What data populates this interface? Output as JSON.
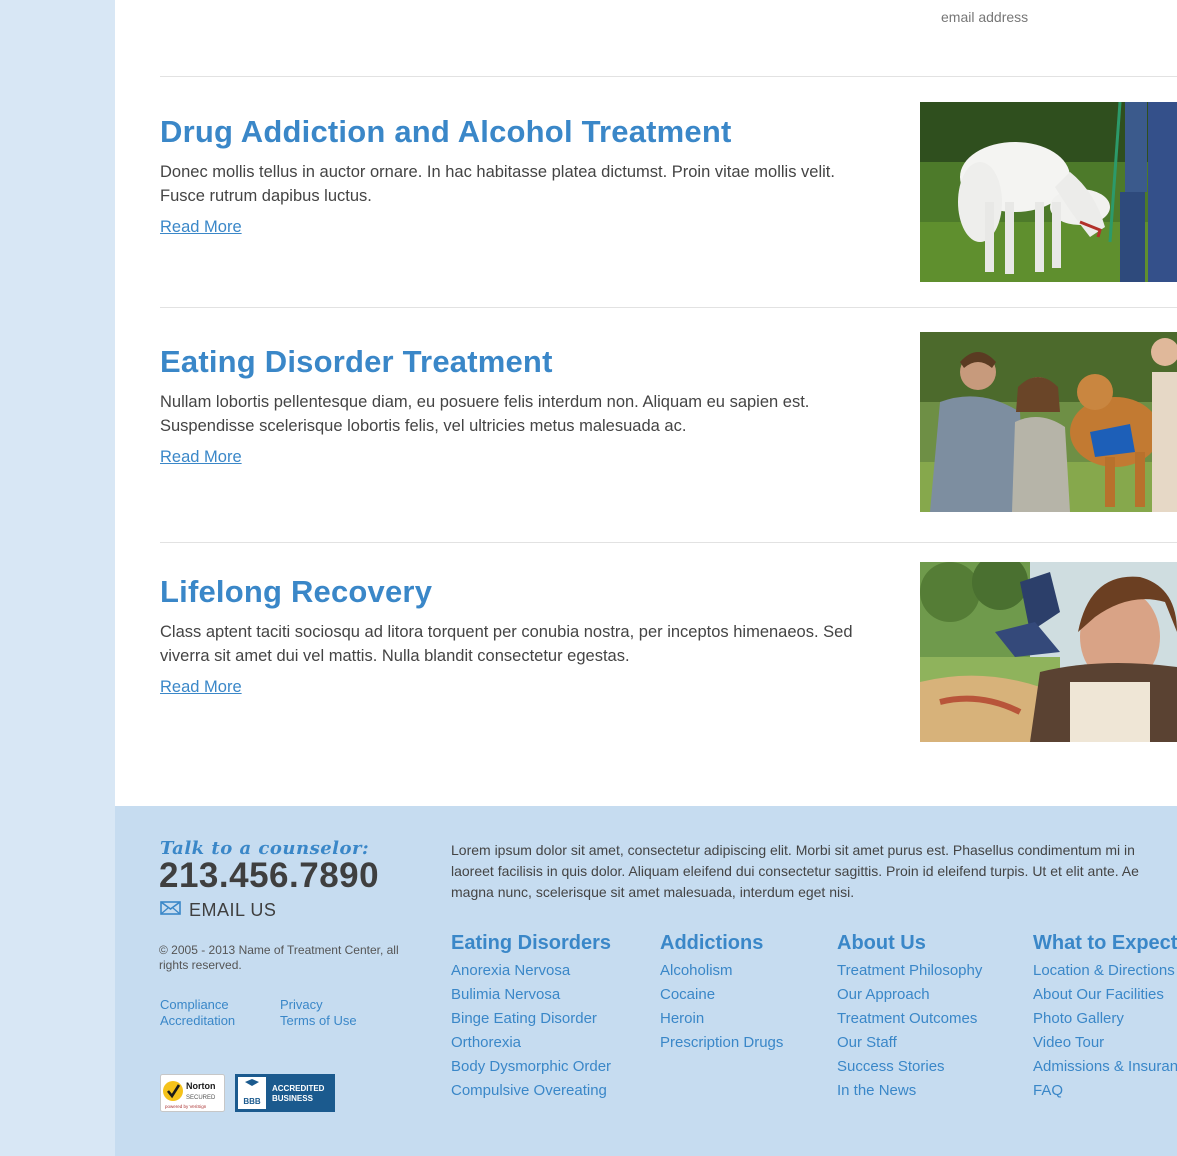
{
  "signup": {
    "email_placeholder": "email address"
  },
  "articles": [
    {
      "title": "Drug Addiction and Alcohol Treatment",
      "body": "Donec mollis tellus in auctor ornare. In hac habitasse platea dictumst. Proin vitae mollis velit. Fusce rutrum dapibus luctus.",
      "link": "Read More",
      "image": "white-horse-photo"
    },
    {
      "title": "Eating Disorder Treatment",
      "body": "Nullam lobortis pellentesque diam, eu posuere felis interdum non. Aliquam eu sapien est. Suspendisse scelerisque lobortis felis, vel ultricies metus malesuada ac.",
      "link": "Read More",
      "image": "women-with-dog-photo"
    },
    {
      "title": "Lifelong Recovery",
      "body": "Class aptent taciti sociosqu ad litora torquent per conubia nostra, per inceptos himenaeos. Sed viverra sit amet dui vel mattis. Nulla blandit consectetur egestas.",
      "link": "Read More",
      "image": "woman-on-blanket-photo"
    }
  ],
  "footer": {
    "talk": "Talk to a counselor:",
    "phone": "213.456.7890",
    "email_label": "EMAIL US",
    "copyright": "© 2005 - 2013 Name of Treatment Center, all rights reserved.",
    "legal": [
      "Compliance",
      "Accreditation",
      "Privacy",
      "Terms of Use"
    ],
    "blurb_lines": [
      "Lorem ipsum dolor sit amet, consectetur adipiscing elit. Morbi sit amet purus est. Phasellus condimentum mi in",
      "laoreet facilisis in quis dolor. Aliquam eleifend dui consectetur sagittis. Proin id eleifend turpis. Ut et elit ante. Ae",
      "magna nunc, scelerisque sit amet malesuada, interdum eget nisi."
    ],
    "columns": [
      {
        "heading": "Eating Disorders",
        "items": [
          "Anorexia Nervosa",
          "Bulimia Nervosa",
          "Binge Eating Disorder",
          "Orthorexia",
          "Body Dysmorphic Order",
          "Compulsive Overeating"
        ]
      },
      {
        "heading": "Addictions",
        "items": [
          "Alcoholism",
          "Cocaine",
          "Heroin",
          "Prescription Drugs"
        ]
      },
      {
        "heading": "About Us",
        "items": [
          "Treatment Philosophy",
          "Our Approach",
          "Treatment Outcomes",
          "Our Staff",
          "Success Stories",
          "In the News"
        ]
      },
      {
        "heading": "What to Expect",
        "items": [
          "Location & Directions",
          "About Our Facilities",
          "Photo Gallery",
          "Video Tour",
          "Admissions & Insurance",
          "FAQ"
        ]
      }
    ],
    "badges": {
      "norton_line1": "Norton",
      "norton_line2": "SECURED",
      "norton_line3": "powered by VeriSign",
      "bbb_logo": "BBB",
      "bbb_line1": "ACCREDITED",
      "bbb_line2": "BUSINESS"
    }
  },
  "colors": {
    "accent": "#3a87c8",
    "footer_bg": "#c6dcf0",
    "side_bg": "#d8e7f5"
  }
}
